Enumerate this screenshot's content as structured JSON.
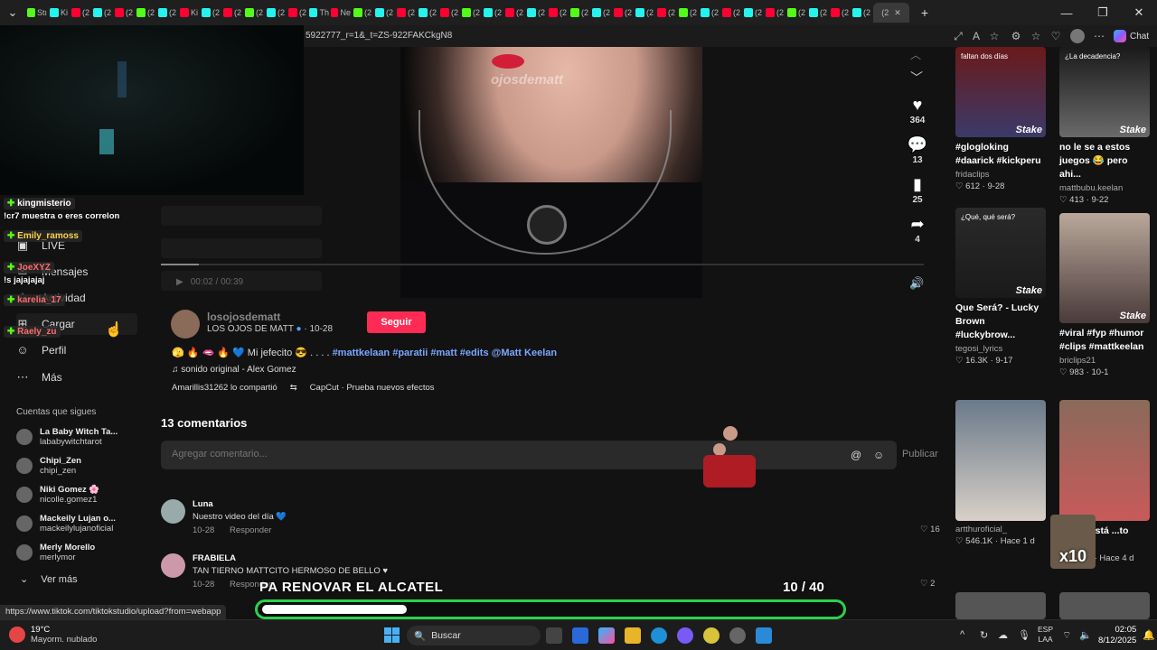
{
  "browser": {
    "url": "5922777_r=1&_t=ZS-922FAKCkgN8",
    "chat_label": "Chat",
    "status_url": "https://www.tiktok.com/tiktokstudio/upload?from=webapp",
    "tabs": [
      "Stı",
      "Ki",
      "(2",
      "(2",
      "(2",
      "(2",
      "(2",
      "Ki",
      "(2",
      "(2",
      "(2",
      "(2",
      "(2",
      "Th",
      "Ne",
      "(2",
      "(2",
      "(2",
      "(2",
      "(2",
      "(2",
      "(2",
      "(2",
      "(2",
      "(2",
      "(2",
      "(2",
      "(2",
      "(2",
      "(2",
      "(2",
      "(2",
      "(2",
      "(2",
      "(2",
      "(2",
      "(2",
      "(2",
      "(2"
    ],
    "active_tab": "(2"
  },
  "sidebar": {
    "items": [
      {
        "label": "LIVE",
        "icon": "live-icon"
      },
      {
        "label": "Mensajes",
        "icon": "message-icon"
      },
      {
        "label": "Actividad",
        "icon": "bell-icon"
      },
      {
        "label": "Cargar",
        "icon": "upload-icon"
      },
      {
        "label": "Perfil",
        "icon": "profile-icon"
      },
      {
        "label": "Más",
        "icon": "more-icon"
      }
    ],
    "following_title": "Cuentas que sigues",
    "accounts": [
      {
        "name": "La Baby Witch Ta...",
        "handle": "lababywitchtarot"
      },
      {
        "name": "Chipi_Zen",
        "handle": "chipi_zen"
      },
      {
        "name": "Niki Gomez 🌸",
        "handle": "nicolle.gomez1"
      },
      {
        "name": "Mackeily Lujan o...",
        "handle": "mackeilylujanoficial"
      },
      {
        "name": "Merly Morello",
        "handle": "merlymor"
      }
    ],
    "see_more": "Ver más"
  },
  "stream_chat": [
    {
      "user": "kingmisterio",
      "type": "user"
    },
    {
      "text": "!cr7 muestra o eres correlon",
      "type": "msg"
    },
    {
      "user": "Emily_ramoss",
      "type": "user"
    },
    {
      "user": "JoeXYZ",
      "type": "user"
    },
    {
      "text": "!s jajajajaj",
      "type": "msg"
    },
    {
      "user": "karelia_17",
      "type": "user"
    },
    {
      "user": "Raely_zu",
      "type": "user"
    }
  ],
  "video": {
    "watermark": "ojosdematt",
    "time": "00:02 / 00:39",
    "progress": 0.05
  },
  "actions": {
    "likes": "364",
    "comments": "13",
    "saves": "25",
    "shares": "4"
  },
  "author": {
    "username": "losojosdematt",
    "display": "LOS OJOS DE MATT",
    "date": "· 10-28",
    "follow_label": "Seguir"
  },
  "caption": {
    "emojis": "🫣 🔥 🫦 🔥 💙",
    "text": "Mi jefecito 😎 . . . .",
    "tags": "#mattkelaan #paratii #matt #edits @Matt Keelan"
  },
  "sound": "♫ sonido original - Alex Gomez",
  "shared": {
    "by": "Amarillis31262 lo compartió",
    "effect": "CapCut · Prueba nuevos efectos"
  },
  "comments": {
    "count_label": "13 comentarios",
    "placeholder": "Agregar comentario...",
    "publish": "Publicar",
    "reply_label": "Responder",
    "list": [
      {
        "name": "Luna",
        "text": "Nuestro video del día 💙",
        "date": "10-28",
        "likes": "16"
      },
      {
        "name": "FRABIELA",
        "text": "TAN TIERNO MATTCITO HERMOSO DE BELLO ♥",
        "date": "10-28",
        "likes": "2"
      }
    ]
  },
  "feed": [
    {
      "caption": "#glogloking #daarick #kickperu",
      "author": "fridaclips",
      "stats": "♡ 612 · 9-28",
      "overlay": "faltan dos días"
    },
    {
      "caption": "no le se a estos juegos 😂 pero ahi...",
      "author": "mattbubu.keelan",
      "stats": "♡ 413 · 9-22",
      "overlay": "¿La decadencia?"
    },
    {
      "caption": "Que Será? - Lucky Brown #luckybrow...",
      "author": "tegosi_lyrics",
      "stats": "♡ 16.3K · 9-17",
      "overlay": "¿Qué, qué será?"
    },
    {
      "caption": "#viral #fyp #humor #clips #mattkeelan",
      "author": "briclips21",
      "stats": "♡ 983 · 10-1",
      "overlay": ""
    },
    {
      "caption": "",
      "author": "artthuroficial_",
      "stats": "♡ 546.1K · Hace 1 d",
      "overlay": ""
    },
    {
      "caption": "lo que está ...to con...",
      "author": "",
      "stats": "♡ 19.8K · Hace 4 d",
      "overlay": ""
    }
  ],
  "stake_label": "Stake",
  "overlay": {
    "goal_label": "PA RENOVAR EL ALCATEL",
    "goal_count": "10 / 40",
    "goal_fraction": 0.25,
    "x10": "x10"
  },
  "taskbar": {
    "temp": "19°C",
    "weather": "Mayorm. nublado",
    "search": "Buscar",
    "lang1": "ESP",
    "lang2": "LAA",
    "time": "02:05",
    "date": "8/12/2025"
  },
  "colors": {
    "follow": "#fe2c55",
    "goal_border": "#2bd14b",
    "kick_green": "#53fc18",
    "hashtag": "#7aa8ff"
  }
}
